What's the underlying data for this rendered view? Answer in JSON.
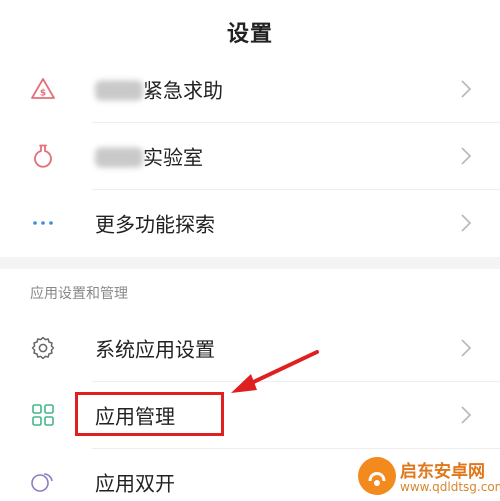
{
  "header": {
    "title": "设置"
  },
  "group1": {
    "items": [
      {
        "label": "紧急求助",
        "icon": "sos-icon",
        "blurred_prefix": true
      },
      {
        "label": "实验室",
        "icon": "lab-flask-icon",
        "blurred_prefix": true
      },
      {
        "label": "更多功能探索",
        "icon": "more-dots-icon",
        "blurred_prefix": false
      }
    ]
  },
  "group2": {
    "title": "应用设置和管理",
    "items": [
      {
        "label": "系统应用设置",
        "icon": "gear-icon"
      },
      {
        "label": "应用管理",
        "icon": "app-grid-icon"
      },
      {
        "label": "应用双开",
        "icon": "dual-circle-icon"
      }
    ]
  },
  "watermark": {
    "name": "启东安卓网",
    "url": "www.qdldtsg.com"
  },
  "colors": {
    "accent_red": "#e02020",
    "sos_icon": "#e4707a",
    "dots_icon": "#3a8fd6",
    "grid_icon": "#44b58a",
    "watermark_orange": "#f28a1e"
  }
}
